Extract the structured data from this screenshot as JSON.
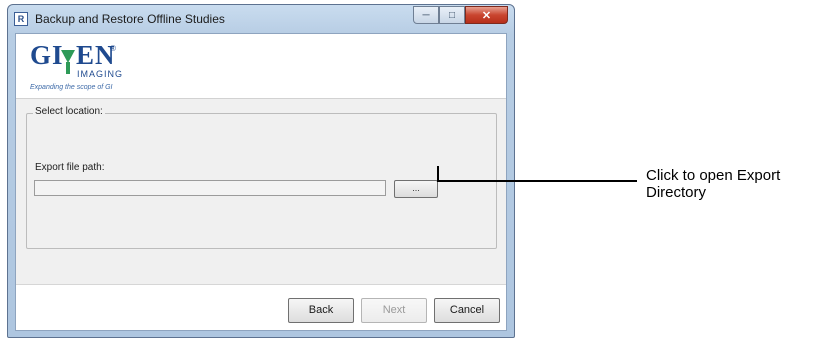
{
  "window": {
    "title": "Backup and Restore Offline Studies",
    "app_icon": "R",
    "controls": {
      "minimize_icon": "minimize-icon",
      "maximize_icon": "maximize-icon",
      "close_icon": "close-icon"
    }
  },
  "logo": {
    "brand": "GIVEN",
    "brand_left": "GI",
    "brand_right": "EN",
    "registered": "®",
    "sub": "IMAGING",
    "tagline": "Expanding the scope of GI"
  },
  "location_group": {
    "legend": "Select location:",
    "export_label": "Export file path:",
    "export_value": "",
    "browse_label": "..."
  },
  "footer": {
    "back_label": "Back",
    "next_label": "Next",
    "cancel_label": "Cancel"
  },
  "annotation": {
    "text": "Click to open Export Directory"
  },
  "colors": {
    "brand_blue": "#1f4a8f",
    "brand_green": "#2e9a58",
    "close_red": "#c9452f"
  }
}
